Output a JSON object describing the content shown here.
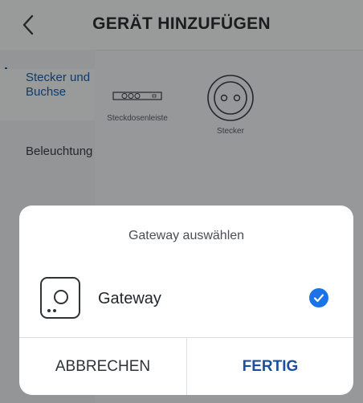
{
  "header": {
    "title": "GERÄT HINZUFÜGEN",
    "back_icon": "chevron-left-icon"
  },
  "sidebar": {
    "items": [
      {
        "label": "Stecker und Buchse",
        "selected": true
      },
      {
        "label": "Beleuchtung",
        "selected": false
      }
    ]
  },
  "devices": [
    {
      "label": "Steckdosenleiste",
      "icon": "power-strip-icon"
    },
    {
      "label": "Stecker",
      "icon": "socket-icon"
    }
  ],
  "dialog": {
    "title": "Gateway auswählen",
    "options": [
      {
        "label": "Gateway",
        "icon": "gateway-icon",
        "checked": true
      }
    ],
    "cancel_label": "ABBRECHEN",
    "done_label": "FERTIG"
  },
  "colors": {
    "accent": "#1c5fa8",
    "check": "#1a73e8",
    "done": "#1c4f9c"
  }
}
